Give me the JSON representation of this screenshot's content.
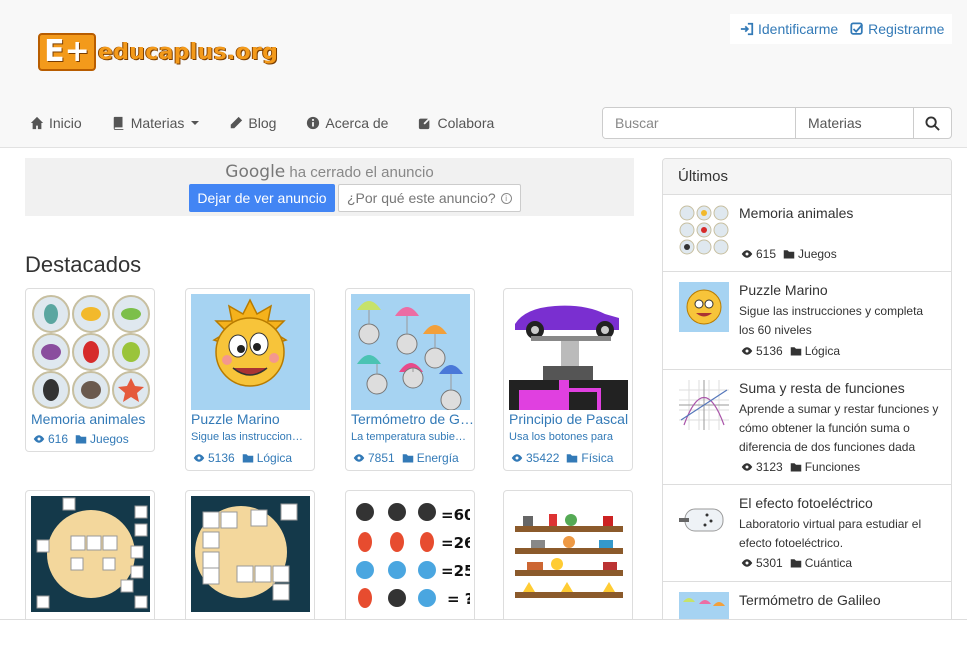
{
  "brand": {
    "mark": "E+",
    "wordmark": "educaplus.org"
  },
  "auth": {
    "login": "Identificarme",
    "register": "Registrarme"
  },
  "nav": [
    {
      "label": "Inicio",
      "icon": "home-icon"
    },
    {
      "label": "Materias",
      "icon": "book-icon",
      "dropdown": true
    },
    {
      "label": "Blog",
      "icon": "pencil-icon"
    },
    {
      "label": "Acerca de",
      "icon": "info-icon"
    },
    {
      "label": "Colabora",
      "icon": "share-icon"
    }
  ],
  "search": {
    "placeholder": "Buscar",
    "category": "Materias"
  },
  "ad": {
    "google": "Google",
    "closed_text": "ha cerrado el anuncio",
    "stop_button": "Dejar de ver anuncio",
    "why_button": "¿Por qué este anuncio?"
  },
  "featured": {
    "heading": "Destacados",
    "cards": [
      {
        "title": "Memoria animales",
        "desc": "",
        "views": "616",
        "category": "Juegos"
      },
      {
        "title": "Puzzle Marino",
        "desc": "Sigue las instrucciones y completa",
        "views": "5136",
        "category": "Lógica"
      },
      {
        "title": "Termómetro de Galileo",
        "desc": "La temperatura subiendo",
        "views": "7851",
        "category": "Energía"
      },
      {
        "title": "Principio de Pascal",
        "desc": "Usa los botones para",
        "views": "35422",
        "category": "Física"
      },
      {
        "title": "",
        "desc": "",
        "views": "",
        "category": ""
      },
      {
        "title": "",
        "desc": "",
        "views": "",
        "category": ""
      },
      {
        "title": "",
        "desc": "",
        "views": "",
        "category": ""
      },
      {
        "title": "",
        "desc": "",
        "views": "",
        "category": ""
      }
    ]
  },
  "sidebar": {
    "heading": "Últimos",
    "items": [
      {
        "title": "Memoria animales",
        "desc": "",
        "views": "615",
        "category": "Juegos"
      },
      {
        "title": "Puzzle Marino",
        "desc": "Sigue las instrucciones y completa los 60 niveles",
        "views": "5136",
        "category": "Lógica"
      },
      {
        "title": "Suma y resta de funciones",
        "desc": "Aprende a sumar y restar funciones y cómo obtener la función suma o diferencia de dos funciones dada",
        "views": "3123",
        "category": "Funciones"
      },
      {
        "title": "El efecto fotoeléctrico",
        "desc": "Laboratorio virtual para estudiar el efecto fotoeléctrico.",
        "views": "5301",
        "category": "Cuántica"
      },
      {
        "title": "Termómetro de Galileo",
        "desc": "",
        "views": "",
        "category": ""
      }
    ]
  },
  "colors": {
    "link": "#337ab7",
    "brand": "#f39a1b",
    "google_blue": "#4285f4"
  }
}
